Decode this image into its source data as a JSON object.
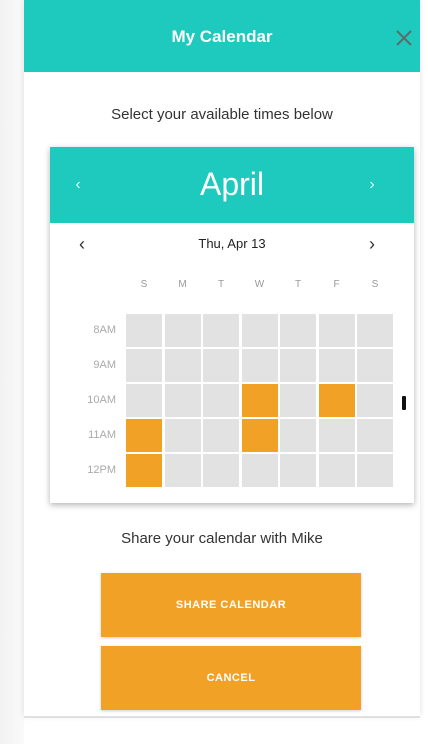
{
  "header": {
    "title": "My Calendar",
    "close_icon": "close-icon"
  },
  "subtitle": "Select your available times below",
  "calendar": {
    "month": "April",
    "date_label": "Thu, Apr 13",
    "days_of_week": [
      "S",
      "M",
      "T",
      "W",
      "T",
      "F",
      "S"
    ],
    "time_slots": [
      "8AM",
      "9AM",
      "10AM",
      "11AM",
      "12PM"
    ],
    "selected": [
      {
        "time": "10AM",
        "day_index": 3
      },
      {
        "time": "10AM",
        "day_index": 5
      },
      {
        "time": "11AM",
        "day_index": 0
      },
      {
        "time": "11AM",
        "day_index": 3
      },
      {
        "time": "12PM",
        "day_index": 0
      }
    ],
    "colors": {
      "header": "#1ec9bd",
      "selected": "#f0a126",
      "empty": "#e2e2e2"
    }
  },
  "share_text": "Share your calendar with Mike",
  "buttons": {
    "share": "SHARE CALENDAR",
    "cancel": "CANCEL"
  }
}
